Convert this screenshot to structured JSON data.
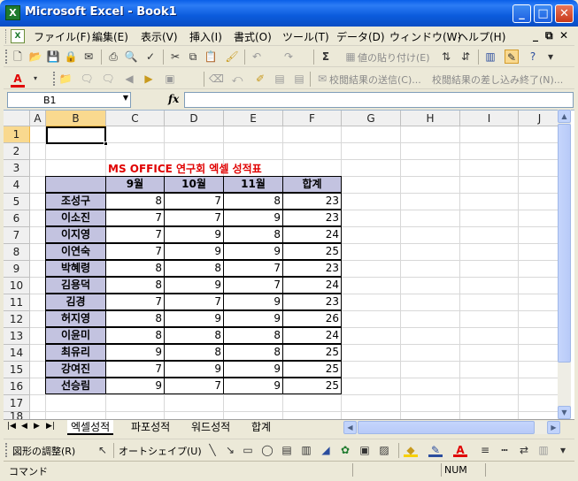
{
  "window": {
    "title": "Microsoft Excel - Book1",
    "app_icon": "excel-icon",
    "buttons": [
      "_",
      "□",
      "✕"
    ]
  },
  "menu": {
    "items": [
      "ファイル(F)",
      "編集(E)",
      "表示(V)",
      "挿入(I)",
      "書式(O)",
      "ツール(T)",
      "データ(D)",
      "ウィンドウ(W)",
      "ヘルプ(H)"
    ],
    "right_controls": [
      "_",
      "⧉",
      "✕"
    ]
  },
  "toolbar1": {
    "sum_label": "Σ",
    "paste_values_label": "値の貼り付け(E)"
  },
  "toolbar2": {
    "review_send": "校閲結果の送信(C)...",
    "review_end": "校閲結果の差し込み終了(N)..."
  },
  "formula": {
    "name_box": "B1",
    "fx": "fx",
    "content": ""
  },
  "columns": [
    "A",
    "B",
    "C",
    "D",
    "E",
    "F",
    "G",
    "H",
    "I",
    "J"
  ],
  "rows": [
    "1",
    "2",
    "3",
    "4",
    "5",
    "6",
    "7",
    "8",
    "9",
    "10",
    "11",
    "12",
    "13",
    "14",
    "15",
    "16",
    "17",
    "18"
  ],
  "sheet": {
    "title": "MS OFFICE 연구회 엑셀 성적표",
    "headers": [
      "",
      "9월",
      "10월",
      "11월",
      "합계"
    ],
    "records": [
      {
        "name": "조성구",
        "m9": "8",
        "m10": "7",
        "m11": "8",
        "total": "23"
      },
      {
        "name": "이소진",
        "m9": "7",
        "m10": "7",
        "m11": "9",
        "total": "23"
      },
      {
        "name": "이지영",
        "m9": "7",
        "m10": "9",
        "m11": "8",
        "total": "24"
      },
      {
        "name": "이연숙",
        "m9": "7",
        "m10": "9",
        "m11": "9",
        "total": "25"
      },
      {
        "name": "박혜령",
        "m9": "8",
        "m10": "8",
        "m11": "7",
        "total": "23"
      },
      {
        "name": "김용덕",
        "m9": "8",
        "m10": "9",
        "m11": "7",
        "total": "24"
      },
      {
        "name": "김경",
        "m9": "7",
        "m10": "7",
        "m11": "9",
        "total": "23"
      },
      {
        "name": "허지영",
        "m9": "8",
        "m10": "9",
        "m11": "9",
        "total": "26"
      },
      {
        "name": "이윤미",
        "m9": "8",
        "m10": "8",
        "m11": "8",
        "total": "24"
      },
      {
        "name": "최유리",
        "m9": "9",
        "m10": "8",
        "m11": "8",
        "total": "25"
      },
      {
        "name": "강여진",
        "m9": "7",
        "m10": "9",
        "m11": "9",
        "total": "25"
      },
      {
        "name": "선승림",
        "m9": "9",
        "m10": "7",
        "m11": "9",
        "total": "25"
      }
    ]
  },
  "tabs": [
    "엑셀성적",
    "파포성적",
    "워드성적",
    "합계"
  ],
  "drawing": {
    "adjust_label": "図形の調整(R)",
    "autoshape_label": "オートシェイプ(U)"
  },
  "status": {
    "mode": "コマンド",
    "num": "NUM"
  },
  "colors": {
    "title_red": "#E00000",
    "header_fill": "#C3C3E0",
    "selection": "#F9D98F"
  }
}
